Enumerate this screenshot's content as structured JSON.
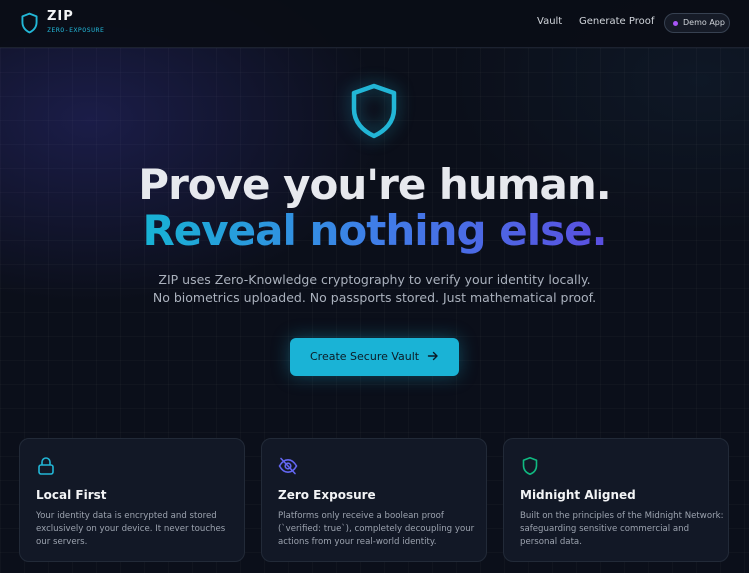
{
  "header": {
    "logo_icon": "shield-icon",
    "title": "ZIP",
    "subtitle": "ZERO-EXPOSURE",
    "nav": {
      "vault_label": "Vault",
      "generate_proof_label": "Generate Proof"
    },
    "demo_badge": {
      "label": "Demo App",
      "dot_color": "#a855f7"
    }
  },
  "hero": {
    "icon": "shield-icon",
    "title_line1": "Prove you're human.",
    "title_line2": "Reveal nothing else.",
    "description_line1": "ZIP uses Zero-Knowledge cryptography to verify your identity locally.",
    "description_line2": "No biometrics uploaded. No passports stored. Just mathematical proof.",
    "cta_label": "Create Secure Vault",
    "cta_icon": "arrow-right-icon"
  },
  "features": [
    {
      "icon": "lock-icon",
      "icon_color": "#22b6d6",
      "title": "Local First",
      "text": "Your identity data is encrypted and stored exclusively on your device. It never touches our servers."
    },
    {
      "icon": "eye-off-icon",
      "icon_color": "#6366f1",
      "title": "Zero Exposure",
      "text": "Platforms only receive a boolean proof (`verified: true`), completely decoupling your actions from your real-world identity."
    },
    {
      "icon": "shield-icon",
      "icon_color": "#10b981",
      "title": "Midnight Aligned",
      "text": "Built on the principles of the Midnight Network: safeguarding sensitive commercial and personal data."
    }
  ],
  "colors": {
    "accent": "#1ab3d6",
    "background": "#0b0f1a",
    "card_background": "#121826"
  }
}
